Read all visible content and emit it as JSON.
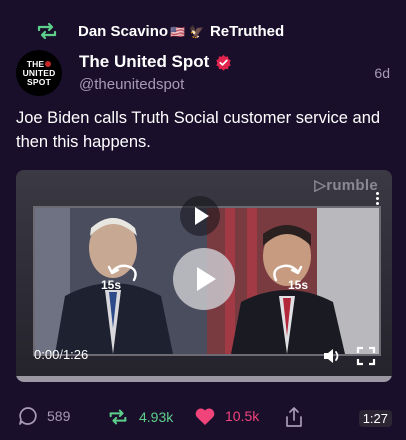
{
  "retruth": {
    "user": "Dan Scavino",
    "flag_emoji": "🇺🇸",
    "eagle_emoji": "🦅",
    "action": "ReTruthed"
  },
  "author": {
    "avatar_lines": [
      "THE",
      "UNITED",
      "SPOT"
    ],
    "name": "The United Spot",
    "handle": "@theunitedspot",
    "verified_icon": "verified-badge-icon",
    "time": "6d"
  },
  "post": {
    "text": "Joe Biden calls Truth Social customer service and then this happens."
  },
  "video": {
    "watermark": "rumble",
    "current_time": "0:00",
    "separator": "/",
    "total_time": "1:26",
    "skip_back_label": "15s",
    "skip_forward_label": "15s",
    "progress": 0,
    "duration_badge": "1:27"
  },
  "actions": {
    "replies": "589",
    "retruths": "4.93k",
    "likes": "10.5k"
  },
  "colors": {
    "background": "#1a0f2b",
    "retruth_green": "#5ccf8b",
    "like_pink": "#f0447a",
    "verified_red": "#e0244d",
    "muted": "#a79ab8"
  }
}
